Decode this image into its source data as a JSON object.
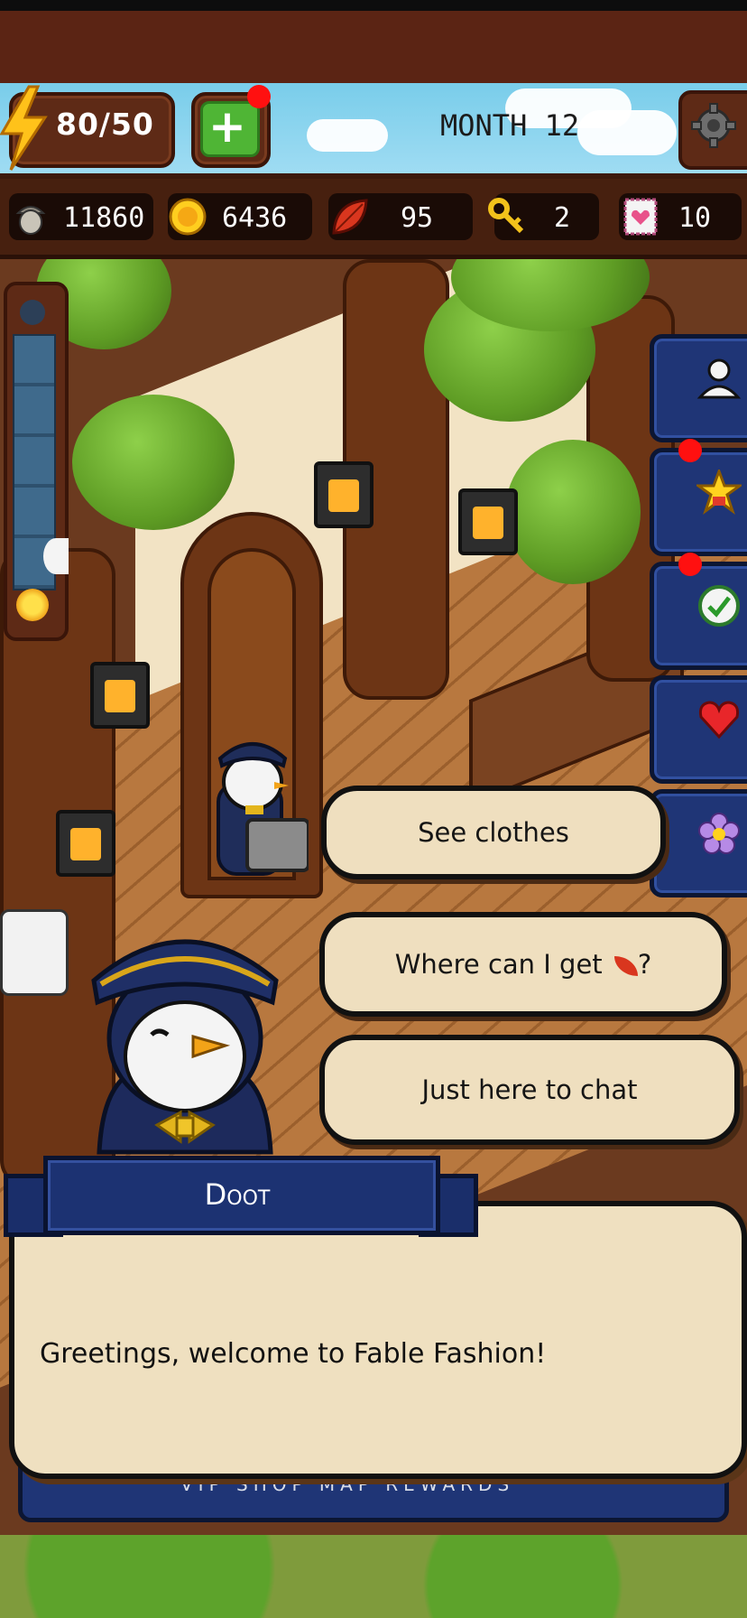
{
  "hud": {
    "energy": "80/50",
    "month": "MONTH 12",
    "currencies": [
      {
        "name": "acorn-icon",
        "value": "11860"
      },
      {
        "name": "coin-icon",
        "value": "6436"
      },
      {
        "name": "leaf-icon",
        "value": "95"
      },
      {
        "name": "key-icon",
        "value": "2"
      },
      {
        "name": "ticket-icon",
        "value": "10"
      }
    ]
  },
  "side_menu": [
    "profile-icon",
    "star-medal-icon",
    "checkmark-icon",
    "heart-icon",
    "flower-icon"
  ],
  "dialogue": {
    "choices": {
      "see_clothes": "See clothes",
      "where_get": "Where can I get",
      "where_get_suffix": "?",
      "chat": "Just here to chat"
    },
    "speaker": "Doot",
    "text": "Greetings, welcome to Fable Fashion!"
  },
  "lower_menu_text": "VIP SHOP     MAP     REWARDS",
  "colors": {
    "hud_brown": "#5e2a16",
    "sky": "#79cdea",
    "menu_blue": "#1f3576",
    "dialog_bg": "#efe0c0",
    "notification_red": "#ff1010"
  }
}
